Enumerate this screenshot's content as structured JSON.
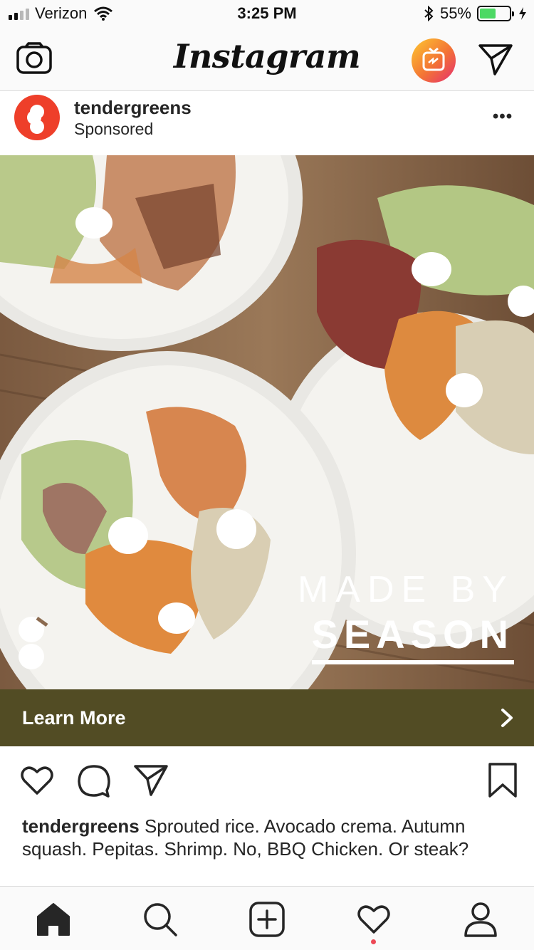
{
  "status_bar": {
    "carrier": "Verizon",
    "time": "3:25 PM",
    "battery_percent": "55%",
    "battery_level": 0.55,
    "signal_bars": 2,
    "icons": [
      "signal-icon",
      "wifi-icon",
      "bluetooth-icon",
      "battery-icon",
      "charging-icon"
    ]
  },
  "top_nav": {
    "logo": "Instagram",
    "icons": [
      "camera-icon",
      "igtv-icon",
      "direct-message-icon"
    ]
  },
  "post": {
    "username": "tendergreens",
    "label": "Sponsored",
    "more": "•••",
    "image": {
      "overlay_line1": "MADE BY",
      "overlay_line2": "SEASON"
    },
    "cta": {
      "label": "Learn More",
      "icon": "chevron-right-icon"
    },
    "actions": [
      "heart-icon",
      "comment-icon",
      "share-icon",
      "bookmark-icon"
    ],
    "caption_user": "tendergreens",
    "caption_text": "Sprouted rice. Avocado crema. Autumn squash. Pepitas. Shrimp. No, BBQ Chicken. Or steak?"
  },
  "tab_bar": {
    "items": [
      "home-icon",
      "search-icon",
      "new-post-icon",
      "activity-icon",
      "profile-icon"
    ],
    "active": "home-icon"
  },
  "colors": {
    "accent_red": "#ee3f2a",
    "cta_bg": "#524c24",
    "battery_green": "#4cd964",
    "notification": "#ed4956"
  }
}
